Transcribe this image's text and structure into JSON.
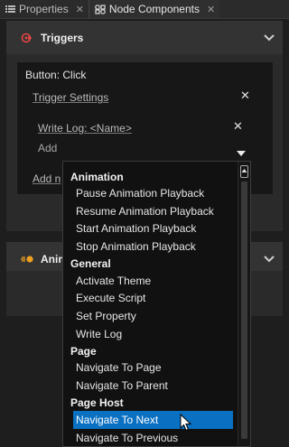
{
  "tabs": [
    {
      "label": "Properties",
      "icon": "list-icon",
      "closable": true
    },
    {
      "label": "Node Components",
      "icon": "node-components-icon",
      "closable": true,
      "active": true
    }
  ],
  "triggers_section": {
    "title": "Triggers",
    "icon": "trigger-icon",
    "card": {
      "title": "Button: Click",
      "trigger_settings": "Trigger Settings",
      "action_link": "Write Log: <Name>",
      "add_label": "Add",
      "add_next_partial": "Add n"
    }
  },
  "animations_section": {
    "title_partial": "Anim",
    "icon": "animation-icon"
  },
  "dropdown": {
    "groups": [
      {
        "category": "Animation",
        "items": [
          "Pause Animation Playback",
          "Resume Animation Playback",
          "Start Animation Playback",
          "Stop Animation Playback"
        ]
      },
      {
        "category": "General",
        "items": [
          "Activate Theme",
          "Execute Script",
          "Set Property",
          "Write Log"
        ]
      },
      {
        "category": "Page",
        "items": [
          "Navigate To Page",
          "Navigate To Parent"
        ]
      },
      {
        "category": "Page Host",
        "items": [
          "Navigate To Next",
          "Navigate To Previous"
        ]
      }
    ],
    "selected": "Navigate To Next"
  },
  "colors": {
    "background": "#1e1e1e",
    "section_header": "#333333",
    "selection": "#0a70c2",
    "trigger_icon": "#e04545",
    "animation_icon": "#f0a020"
  }
}
